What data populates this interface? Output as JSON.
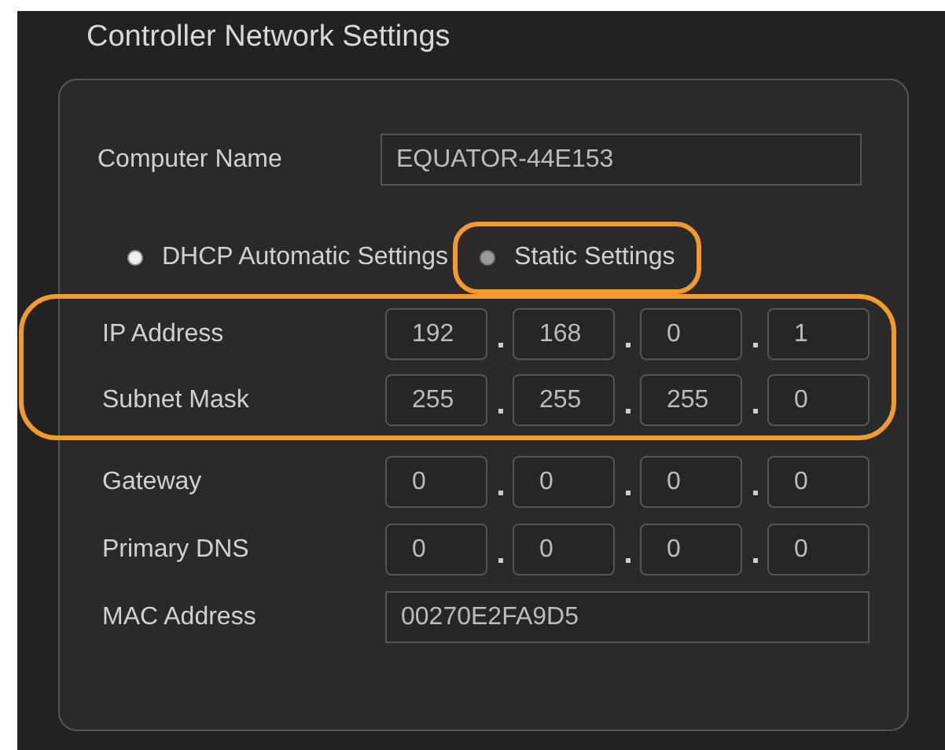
{
  "title": "Controller Network Settings",
  "computer_name": {
    "label": "Computer Name",
    "value": "EQUATOR-44E153"
  },
  "modes": [
    {
      "label": "DHCP Automatic Settings",
      "selected": true,
      "highlighted": false
    },
    {
      "label": "Static Settings",
      "selected": false,
      "highlighted": true
    }
  ],
  "addresses": [
    {
      "label": "IP Address",
      "octets": [
        "192",
        "168",
        "0",
        "1"
      ],
      "highlighted": true
    },
    {
      "label": "Subnet Mask",
      "octets": [
        "255",
        "255",
        "255",
        "0"
      ],
      "highlighted": true
    },
    {
      "label": "Gateway",
      "octets": [
        "0",
        "0",
        "0",
        "0"
      ],
      "highlighted": false
    },
    {
      "label": "Primary DNS",
      "octets": [
        "0",
        "0",
        "0",
        "0"
      ],
      "highlighted": false
    }
  ],
  "mac_address": {
    "label": "MAC Address",
    "value": "00270E2FA9D5"
  }
}
